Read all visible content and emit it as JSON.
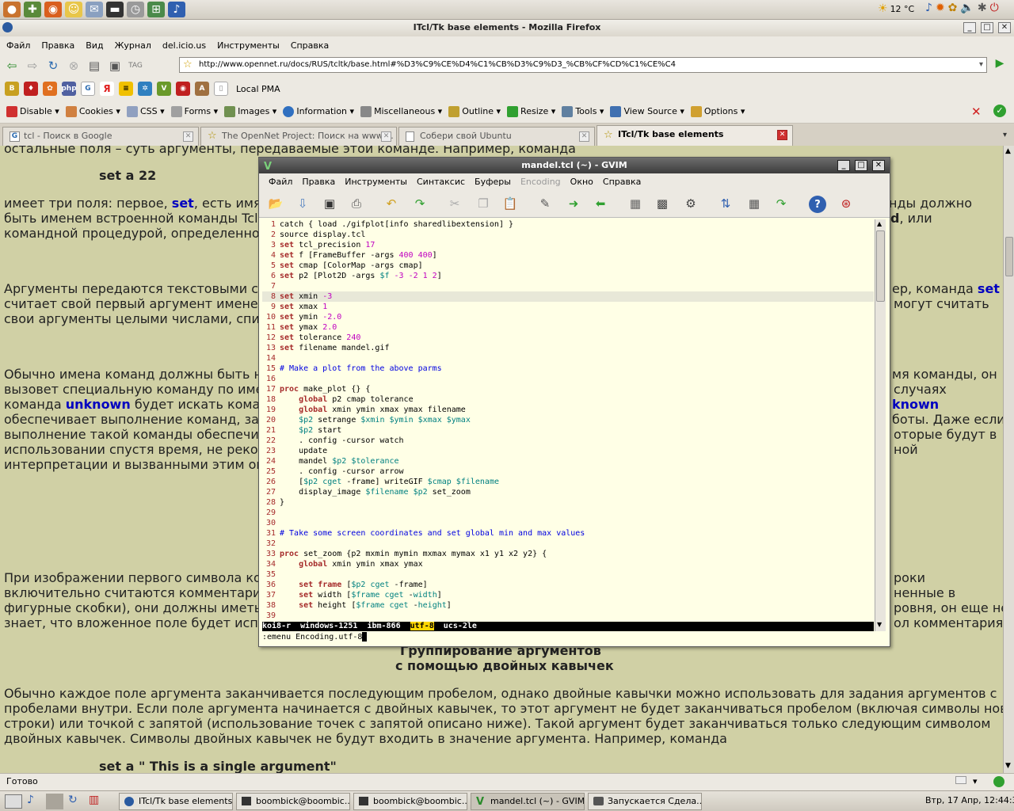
{
  "top_panel": {
    "weather": "12 °C"
  },
  "firefox": {
    "title": "ITcl/Tk base elements - Mozilla Firefox",
    "menu": [
      "Файл",
      "Правка",
      "Вид",
      "Журнал",
      "del.icio.us",
      "Инструменты",
      "Справка"
    ],
    "url": "http://www.opennet.ru/docs/RUS/tcltk/base.html#%D3%C9%CE%D4%C1%CB%D3%C9%D3_%CB%CF%CD%C1%CE%C4",
    "bookmark_local": "Local PMA",
    "webdev": [
      "Disable",
      "Cookies",
      "CSS",
      "Forms",
      "Images",
      "Information",
      "Miscellaneous",
      "Outline",
      "Resize",
      "Tools",
      "View Source",
      "Options"
    ],
    "tabs": [
      "tcl - Поиск в Google",
      "The OpenNet Project: Поиск на www....",
      "Собери свой Ubuntu",
      "ITcl/Tk base elements"
    ],
    "status": "Готово"
  },
  "page": {
    "l1": "остальные поля – суть аргументы, передаваемые этой команде. Например, команда",
    "l2": "set a 22",
    "l3a": "имеет три поля: первое, ",
    "l3k": "set",
    "l3b": ", есть имя к",
    "l3c": "нды должно",
    "l4a": "быть именем встроенной команды Tcl, д",
    "l4c": "d",
    "l4d": ", или",
    "l5": "командной процедурой, определенной",
    "l6a": "Аргументы передаются текстовыми стр",
    "l6b": "ер, команда ",
    "l6k": "set",
    "l7a": "считает свой первый аргумент именем п",
    "l7b": "могут считать",
    "l8": "свои аргументы целыми числами, списк",
    "l9a": "Обычно имена команд должны быть нап",
    "l9b": "мя команды, он",
    "l10a": "вызовет специальную команду по имен",
    "l10b": "случаях",
    "l11a": "команда ",
    "l11k": "unknown",
    "l11b": " будет искать коман",
    "l11c": "known",
    "l12a": "обеспечивает выполнение команд, зада",
    "l12b": "боты. Даже если",
    "l13a": "выполнение такой команды обеспечива",
    "l13b": "оторые будут в",
    "l14a": "использовании спустя время, не рекоме",
    "l14b": "ной",
    "l15": "интерпретации и вызванными этим оши",
    "l16a": "При изображении первого символа кома",
    "l16b": "роки",
    "l17a": "включительно считаются комментарием",
    "l17b": "ненные в",
    "l18a": "фигурные скобки), они должны иметь п",
    "l18b": "ровня, он еще не",
    "l19a": "знает, что вложенное поле будет испол",
    "l19b": "ол комментария.",
    "h1": "Группирование аргументов",
    "h2": "с помощью двойных кавычек",
    "p1": "Обычно каждое поле аргумента заканчивается последующим пробелом, однако двойные кавычки можно использовать для задания аргументов с",
    "p2": "пробелами внутри. Если поле аргумента начинается с двойных кавычек, то этот аргумент не будет заканчиваться пробелом (включая символы новой",
    "p3": "строки) или точкой с запятой (использование точек с запятой описано ниже). Такой аргумент будет заканчиваться только следующим символом",
    "p4": "двойных кавычек. Символы двойных кавычек не будут входить в значение аргумента. Например, команда",
    "p5": "set a \" This is a single argument\""
  },
  "gvim": {
    "title": "mandel.tcl (~) - GVIM",
    "menu": [
      "Файл",
      "Правка",
      "Инструменты",
      "Синтаксис",
      "Буферы",
      "Encoding",
      "Окно",
      "Справка"
    ],
    "status": "koi8-r  windows-1251  ibm-866  ",
    "status_sel": "utf-8",
    "status_end": "  ucs-2le",
    "cmd": ":emenu Encoding.utf-8",
    "code": [
      {
        "n": "1",
        "t": [
          [
            "",
            "catch { load ./gifplot[info sharedlibextension] }"
          ]
        ]
      },
      {
        "n": "2",
        "t": [
          [
            "",
            "source display.tcl"
          ]
        ]
      },
      {
        "n": "3",
        "t": [
          [
            "k",
            "set"
          ],
          [
            "",
            " tcl_precision "
          ],
          [
            "n",
            "17"
          ]
        ]
      },
      {
        "n": "4",
        "t": [
          [
            "k",
            "set"
          ],
          [
            "",
            " f [FrameBuffer -args "
          ],
          [
            "n",
            "400 400"
          ],
          [
            "",
            "]"
          ]
        ]
      },
      {
        "n": "5",
        "t": [
          [
            "k",
            "set"
          ],
          [
            "",
            " cmap [ColorMap -args cmap]"
          ]
        ]
      },
      {
        "n": "6",
        "t": [
          [
            "k",
            "set"
          ],
          [
            "",
            " p2 [Plot2D -args "
          ],
          [
            "v",
            "$f"
          ],
          [
            "",
            " "
          ],
          [
            "n",
            "-3 -2 1 2"
          ],
          [
            "",
            "]"
          ]
        ]
      },
      {
        "n": "7",
        "t": []
      },
      {
        "n": "8",
        "t": [
          [
            "k",
            "set"
          ],
          [
            "",
            " xmin "
          ],
          [
            "n",
            "-3"
          ]
        ],
        "cur": true
      },
      {
        "n": "9",
        "t": [
          [
            "k",
            "set"
          ],
          [
            "",
            " xmax "
          ],
          [
            "n",
            "1"
          ]
        ]
      },
      {
        "n": "10",
        "t": [
          [
            "k",
            "set"
          ],
          [
            "",
            " ymin "
          ],
          [
            "n",
            "-2.0"
          ]
        ]
      },
      {
        "n": "11",
        "t": [
          [
            "k",
            "set"
          ],
          [
            "",
            " ymax "
          ],
          [
            "n",
            "2.0"
          ]
        ]
      },
      {
        "n": "12",
        "t": [
          [
            "k",
            "set"
          ],
          [
            "",
            " tolerance "
          ],
          [
            "n",
            "240"
          ]
        ]
      },
      {
        "n": "13",
        "t": [
          [
            "k",
            "set"
          ],
          [
            "",
            " filename mandel.gif"
          ]
        ]
      },
      {
        "n": "14",
        "t": []
      },
      {
        "n": "15",
        "t": [
          [
            "c",
            "# Make a plot from the above parms"
          ]
        ]
      },
      {
        "n": "16",
        "t": []
      },
      {
        "n": "17",
        "t": [
          [
            "k",
            "proc"
          ],
          [
            "",
            " make_plot {} {"
          ]
        ]
      },
      {
        "n": "18",
        "t": [
          [
            "",
            "    "
          ],
          [
            "k",
            "global"
          ],
          [
            "",
            " p2 cmap tolerance"
          ]
        ]
      },
      {
        "n": "19",
        "t": [
          [
            "",
            "    "
          ],
          [
            "k",
            "global"
          ],
          [
            "",
            " xmin ymin xmax ymax filename"
          ]
        ]
      },
      {
        "n": "20",
        "t": [
          [
            "",
            "    "
          ],
          [
            "v",
            "$p2"
          ],
          [
            "",
            " setrange "
          ],
          [
            "v",
            "$xmin $ymin $xmax $ymax"
          ]
        ]
      },
      {
        "n": "21",
        "t": [
          [
            "",
            "    "
          ],
          [
            "v",
            "$p2"
          ],
          [
            "",
            " start"
          ]
        ]
      },
      {
        "n": "22",
        "t": [
          [
            "",
            "    . config -cursor watch"
          ]
        ]
      },
      {
        "n": "23",
        "t": [
          [
            "",
            "    update"
          ]
        ]
      },
      {
        "n": "24",
        "t": [
          [
            "",
            "    mandel "
          ],
          [
            "v",
            "$p2 $tolerance"
          ]
        ]
      },
      {
        "n": "25",
        "t": [
          [
            "",
            "    . config -cursor arrow"
          ]
        ]
      },
      {
        "n": "26",
        "t": [
          [
            "",
            "    ["
          ],
          [
            "v",
            "$p2"
          ],
          [
            "",
            " "
          ],
          [
            "v",
            "cget"
          ],
          [
            "",
            " -frame] writeGIF "
          ],
          [
            "v",
            "$cmap $filename"
          ]
        ]
      },
      {
        "n": "27",
        "t": [
          [
            "",
            "    display_image "
          ],
          [
            "v",
            "$filename $p2"
          ],
          [
            "",
            " set_zoom"
          ]
        ]
      },
      {
        "n": "28",
        "t": [
          [
            "",
            "}"
          ]
        ]
      },
      {
        "n": "29",
        "t": []
      },
      {
        "n": "30",
        "t": []
      },
      {
        "n": "31",
        "t": [
          [
            "c",
            "# Take some screen coordinates and set global min and max values"
          ]
        ]
      },
      {
        "n": "32",
        "t": []
      },
      {
        "n": "33",
        "t": [
          [
            "k",
            "proc"
          ],
          [
            "",
            " set_zoom {p2 mxmin mymin mxmax mymax x1 y1 x2 y2} {"
          ]
        ]
      },
      {
        "n": "34",
        "t": [
          [
            "",
            "    "
          ],
          [
            "k",
            "global"
          ],
          [
            "",
            " xmin ymin xmax ymax"
          ]
        ]
      },
      {
        "n": "35",
        "t": []
      },
      {
        "n": "36",
        "t": [
          [
            "",
            "    "
          ],
          [
            "k",
            "set"
          ],
          [
            "",
            " "
          ],
          [
            "k",
            "frame"
          ],
          [
            "",
            " ["
          ],
          [
            "v",
            "$p2"
          ],
          [
            "",
            " "
          ],
          [
            "v",
            "cget"
          ],
          [
            "",
            " -frame]"
          ]
        ]
      },
      {
        "n": "37",
        "t": [
          [
            "",
            "    "
          ],
          [
            "k",
            "set"
          ],
          [
            "",
            " width ["
          ],
          [
            "v",
            "$frame"
          ],
          [
            "",
            " "
          ],
          [
            "v",
            "cget"
          ],
          [
            "",
            " -"
          ],
          [
            "v",
            "width"
          ],
          [
            "",
            "]"
          ]
        ]
      },
      {
        "n": "38",
        "t": [
          [
            "",
            "    "
          ],
          [
            "k",
            "set"
          ],
          [
            "",
            " height ["
          ],
          [
            "v",
            "$frame"
          ],
          [
            "",
            " "
          ],
          [
            "v",
            "cget"
          ],
          [
            "",
            " -"
          ],
          [
            "v",
            "height"
          ],
          [
            "",
            "]"
          ]
        ]
      },
      {
        "n": "39",
        "t": []
      }
    ]
  },
  "taskbar": {
    "items": [
      "ITcl/Tk base elements ...",
      "boombick@boombic...",
      "boombick@boombic...",
      "mandel.tcl (~) - GVIM",
      "Запускается Сдела..."
    ],
    "clock": "Втр, 17 Апр, 12:44:31"
  }
}
